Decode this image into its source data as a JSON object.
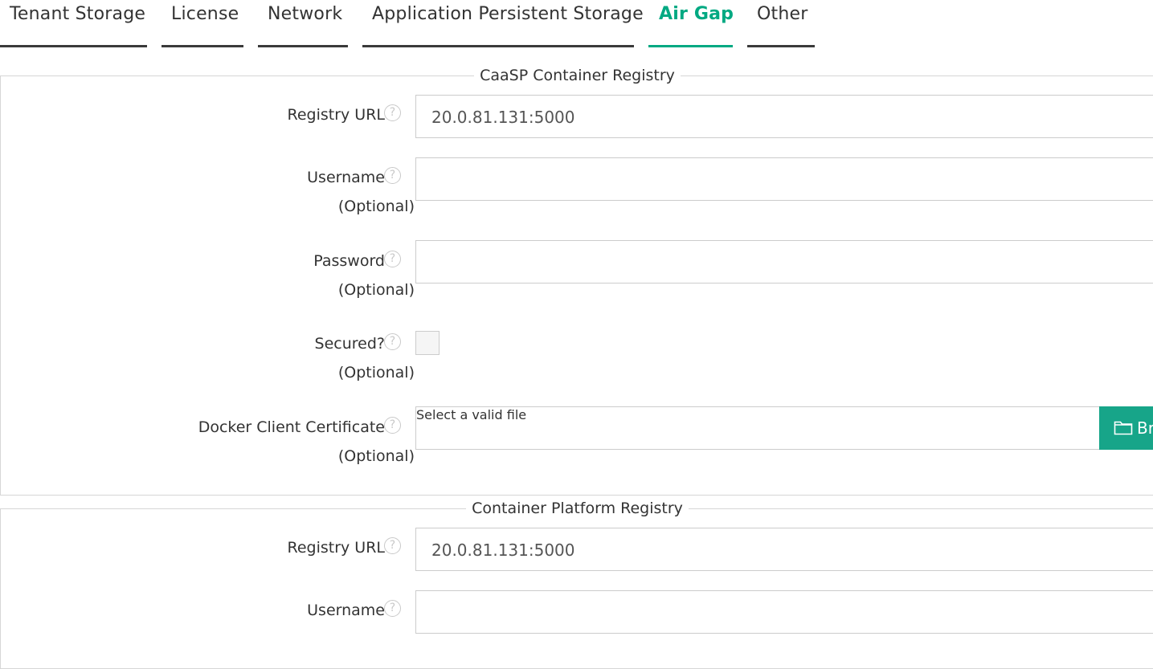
{
  "tabs": [
    {
      "label": "Tenant Storage",
      "active": false
    },
    {
      "label": "License",
      "active": false
    },
    {
      "label": "Network",
      "active": false
    },
    {
      "label": "Application Persistent Storage",
      "active": false
    },
    {
      "label": "Air Gap",
      "active": true
    },
    {
      "label": "Other",
      "active": false
    }
  ],
  "colors": {
    "accent": "#01a982",
    "button": "#17a589"
  },
  "help_icon": "?",
  "caasp": {
    "title": "CaaSP Container Registry",
    "registry_url_label": "Registry URL",
    "registry_url_value": "20.0.81.131:5000",
    "username_label": "Username",
    "username_value": "",
    "password_label": "Password",
    "password_value": "",
    "secured_label": "Secured?",
    "secured_checked": false,
    "cert_label": "Docker Client Certificate",
    "cert_placeholder": "Select a valid file",
    "browse_label": "Br",
    "optional": "(Optional)"
  },
  "platform": {
    "title": "Container Platform Registry",
    "registry_url_label": "Registry URL",
    "registry_url_value": "20.0.81.131:5000",
    "username_label": "Username",
    "username_value": ""
  }
}
